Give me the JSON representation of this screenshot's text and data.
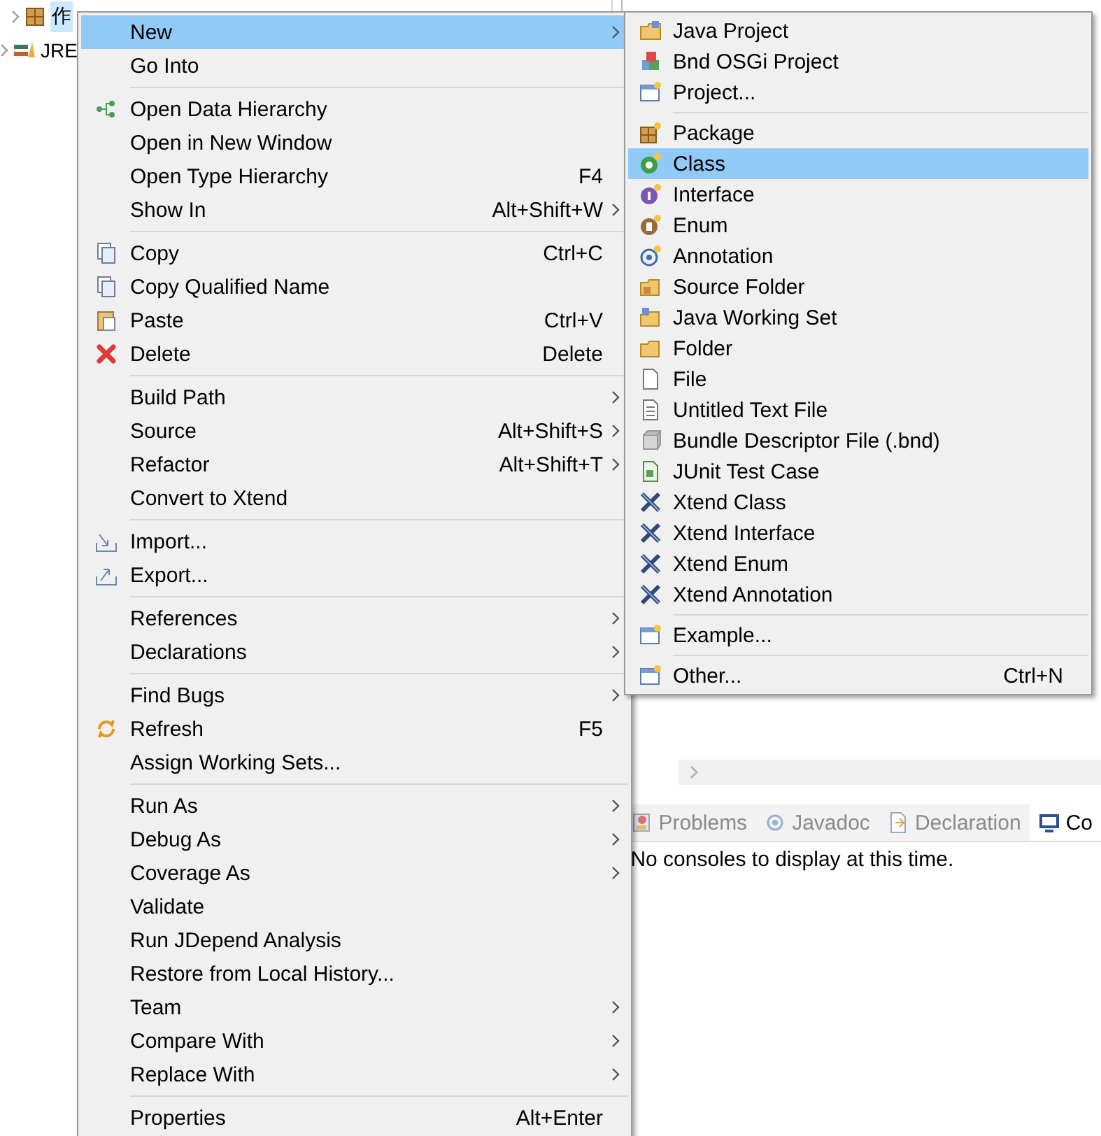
{
  "project_tree": {
    "items": [
      {
        "label": "作",
        "expanded": false,
        "selected": true
      },
      {
        "label": "JRE",
        "expanded": false,
        "selected": false
      }
    ]
  },
  "console": {
    "tabs": [
      {
        "label": "Problems",
        "selected": false
      },
      {
        "label": "Javadoc",
        "selected": false
      },
      {
        "label": "Declaration",
        "selected": false
      },
      {
        "label": "Co",
        "selected": true
      }
    ],
    "message": "No consoles to display at this time."
  },
  "context_menu": {
    "groups": [
      [
        {
          "label": "New",
          "submenu": true,
          "selected": true
        },
        {
          "label": "Go Into",
          "submenu": false,
          "selected": false
        }
      ],
      [
        {
          "label": "Open Data Hierarchy",
          "submenu": false,
          "selected": false
        },
        {
          "label": "Open in New Window",
          "submenu": false,
          "selected": false
        },
        {
          "label": "Open Type Hierarchy",
          "shortcut": "F4",
          "submenu": false,
          "selected": false
        },
        {
          "label": "Show In",
          "shortcut": "Alt+Shift+W",
          "submenu": true,
          "selected": false
        }
      ],
      [
        {
          "label": "Copy",
          "shortcut": "Ctrl+C",
          "submenu": false,
          "selected": false
        },
        {
          "label": "Copy Qualified Name",
          "submenu": false,
          "selected": false
        },
        {
          "label": "Paste",
          "shortcut": "Ctrl+V",
          "submenu": false,
          "selected": false
        },
        {
          "label": "Delete",
          "shortcut": "Delete",
          "submenu": false,
          "selected": false
        }
      ],
      [
        {
          "label": "Build Path",
          "submenu": true,
          "selected": false
        },
        {
          "label": "Source",
          "shortcut": "Alt+Shift+S",
          "submenu": true,
          "selected": false
        },
        {
          "label": "Refactor",
          "shortcut": "Alt+Shift+T",
          "submenu": true,
          "selected": false
        },
        {
          "label": "Convert to Xtend",
          "submenu": false,
          "selected": false
        }
      ],
      [
        {
          "label": "Import...",
          "submenu": false,
          "selected": false
        },
        {
          "label": "Export...",
          "submenu": false,
          "selected": false
        }
      ],
      [
        {
          "label": "References",
          "submenu": true,
          "selected": false
        },
        {
          "label": "Declarations",
          "submenu": true,
          "selected": false
        }
      ],
      [
        {
          "label": "Find Bugs",
          "submenu": true,
          "selected": false
        },
        {
          "label": "Refresh",
          "shortcut": "F5",
          "submenu": false,
          "selected": false
        },
        {
          "label": "Assign Working Sets...",
          "submenu": false,
          "selected": false
        }
      ],
      [
        {
          "label": "Run As",
          "submenu": true,
          "selected": false
        },
        {
          "label": "Debug As",
          "submenu": true,
          "selected": false
        },
        {
          "label": "Coverage As",
          "submenu": true,
          "selected": false
        },
        {
          "label": "Validate",
          "submenu": false,
          "selected": false
        },
        {
          "label": "Run JDepend Analysis",
          "submenu": false,
          "selected": false
        },
        {
          "label": "Restore from Local History...",
          "submenu": false,
          "selected": false
        },
        {
          "label": "Team",
          "submenu": true,
          "selected": false
        },
        {
          "label": "Compare With",
          "submenu": true,
          "selected": false
        },
        {
          "label": "Replace With",
          "submenu": true,
          "selected": false
        }
      ],
      [
        {
          "label": "Properties",
          "shortcut": "Alt+Enter",
          "submenu": false,
          "selected": false
        }
      ]
    ]
  },
  "new_submenu": {
    "groups": [
      [
        {
          "label": "Java Project",
          "selected": false
        },
        {
          "label": "Bnd OSGi Project",
          "selected": false
        },
        {
          "label": "Project...",
          "selected": false
        }
      ],
      [
        {
          "label": "Package",
          "selected": false
        },
        {
          "label": "Class",
          "selected": true
        },
        {
          "label": "Interface",
          "selected": false
        },
        {
          "label": "Enum",
          "selected": false
        },
        {
          "label": "Annotation",
          "selected": false
        },
        {
          "label": "Source Folder",
          "selected": false
        },
        {
          "label": "Java Working Set",
          "selected": false
        },
        {
          "label": "Folder",
          "selected": false
        },
        {
          "label": "File",
          "selected": false
        },
        {
          "label": "Untitled Text File",
          "selected": false
        },
        {
          "label": "Bundle Descriptor File (.bnd)",
          "selected": false
        },
        {
          "label": "JUnit Test Case",
          "selected": false
        },
        {
          "label": "Xtend Class",
          "selected": false
        },
        {
          "label": "Xtend Interface",
          "selected": false
        },
        {
          "label": "Xtend Enum",
          "selected": false
        },
        {
          "label": "Xtend Annotation",
          "selected": false
        }
      ],
      [
        {
          "label": "Example...",
          "selected": false
        }
      ],
      [
        {
          "label": "Other...",
          "shortcut": "Ctrl+N",
          "selected": false
        }
      ]
    ]
  }
}
